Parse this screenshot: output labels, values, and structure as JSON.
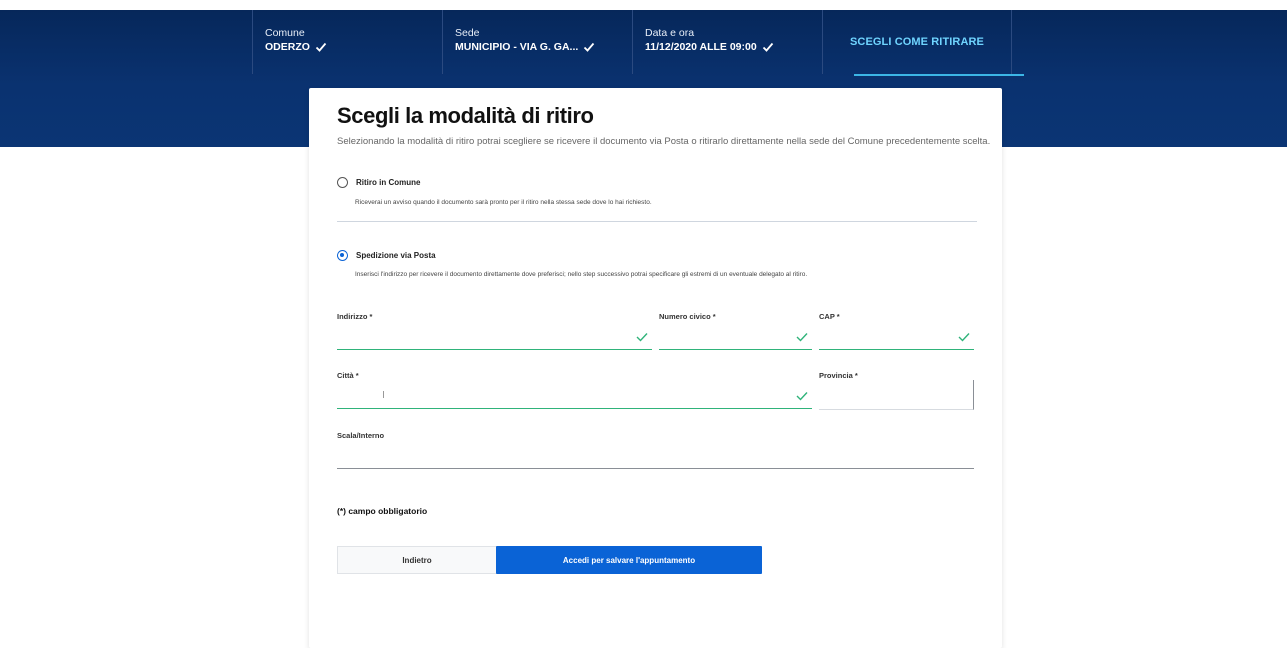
{
  "header": {
    "steps": [
      {
        "label": "Comune",
        "value": "ODERZO"
      },
      {
        "label": "Sede",
        "value": "MUNICIPIO - VIA G. GA..."
      },
      {
        "label": "Data e ora",
        "value": "11/12/2020 ALLE 09:00"
      },
      {
        "active_label": "SCEGLI COME RITIRARE"
      }
    ]
  },
  "card": {
    "title": "Scegli la modalità di ritiro",
    "subtitle": "Selezionando la modalità di ritiro potrai scegliere se ricevere il documento via Posta o ritirarlo direttamente nella sede del Comune precedentemente scelta.",
    "options": [
      {
        "label": "Ritiro in Comune",
        "description": "Riceverai un avviso quando il documento sarà pronto per il ritiro nella stessa sede dove lo hai richiesto.",
        "selected": false
      },
      {
        "label": "Spedizione via Posta",
        "description": "Inserisci l'indirizzo per ricevere il documento direttamente dove preferisci; nello step successivo potrai specificare gli estremi di un eventuale delegato al ritiro.",
        "selected": true
      }
    ],
    "fields": {
      "indirizzo": {
        "label": "Indirizzo *",
        "value": ""
      },
      "numero_civico": {
        "label": "Numero civico *",
        "value": ""
      },
      "cap": {
        "label": "CAP *",
        "value": ""
      },
      "citta": {
        "label": "Città *",
        "value": ""
      },
      "provincia": {
        "label": "Provincia *",
        "value": ""
      },
      "scala_interno": {
        "label": "Scala/Interno",
        "value": ""
      }
    },
    "required_note": "(*) campo obbligatorio",
    "buttons": {
      "back": "Indietro",
      "primary": "Accedi per salvare l'appuntamento"
    }
  },
  "colors": {
    "header_bg": "#0a3270",
    "accent": "#0a63d6",
    "valid": "#2fb37a",
    "active_step": "#6fd4ff"
  }
}
